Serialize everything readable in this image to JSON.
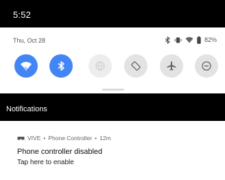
{
  "status_bar": {
    "time": "5:52"
  },
  "quick_settings": {
    "date": "Thu, Oct 28",
    "battery": "82%",
    "tiles": [
      {
        "name": "wifi",
        "icon": "wifi-icon",
        "state": "on"
      },
      {
        "name": "bluetooth",
        "icon": "bluetooth-icon",
        "state": "on"
      },
      {
        "name": "data-saver",
        "icon": "globe-icon",
        "state": "faded"
      },
      {
        "name": "auto-rotate",
        "icon": "rotate-icon",
        "state": "off"
      },
      {
        "name": "airplane-mode",
        "icon": "airplane-icon",
        "state": "off"
      },
      {
        "name": "do-not-disturb",
        "icon": "minus-circle-icon",
        "state": "off"
      }
    ]
  },
  "notifications": {
    "header": "Notifications",
    "items": [
      {
        "app": "VIVE",
        "source": "Phone Controller",
        "time": "12m",
        "title": "Phone controller disabled",
        "body": "Tap here to enable"
      }
    ]
  },
  "colors": {
    "accent": "#4285f4",
    "tile_off": "#e3e3e3",
    "dark": "#000000"
  }
}
